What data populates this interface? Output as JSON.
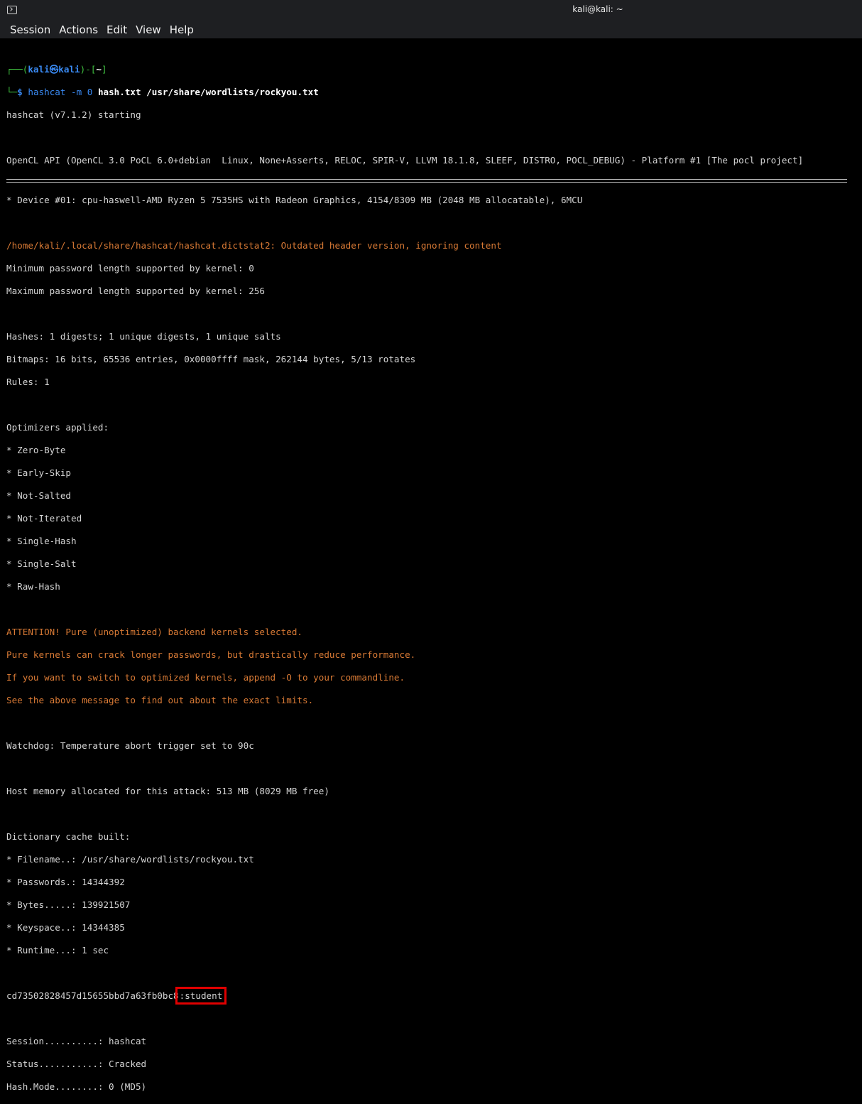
{
  "window": {
    "title": "kali@kali: ~"
  },
  "menu": [
    "Session",
    "Actions",
    "Edit",
    "View",
    "Help"
  ],
  "prompt": {
    "corner_top": "┌──(",
    "user": "kali",
    "at": "㉿",
    "host": "kali",
    "mid": ")-[",
    "dir": "~",
    "end": "]",
    "corner_bottom": "└─",
    "dollar": "$",
    "cmd": "hashcat",
    "args": " -m 0 ",
    "file_args": "hash.txt /usr/share/wordlists/rockyou.txt"
  },
  "lines": {
    "l1": "hashcat (v7.1.2) starting",
    "l2": "OpenCL API (OpenCL 3.0 PoCL 6.0+debian  Linux, None+Asserts, RELOC, SPIR-V, LLVM 18.1.8, SLEEF, DISTRO, POCL_DEBUG) - Platform #1 [The pocl project]",
    "l3": "* Device #01: cpu-haswell-AMD Ryzen 5 7535HS with Radeon Graphics, 4154/8309 MB (2048 MB allocatable), 6MCU",
    "l4": "/home/kali/.local/share/hashcat/hashcat.dictstat2: Outdated header version, ignoring content",
    "l5": "Minimum password length supported by kernel: 0",
    "l6": "Maximum password length supported by kernel: 256",
    "l7": "Hashes: 1 digests; 1 unique digests, 1 unique salts",
    "l8": "Bitmaps: 16 bits, 65536 entries, 0x0000ffff mask, 262144 bytes, 5/13 rotates",
    "l9": "Rules: 1",
    "l10": "Optimizers applied:",
    "l11": "* Zero-Byte",
    "l12": "* Early-Skip",
    "l13": "* Not-Salted",
    "l14": "* Not-Iterated",
    "l15": "* Single-Hash",
    "l16": "* Single-Salt",
    "l17": "* Raw-Hash",
    "l18": "ATTENTION! Pure (unoptimized) backend kernels selected.",
    "l19": "Pure kernels can crack longer passwords, but drastically reduce performance.",
    "l20": "If you want to switch to optimized kernels, append -O to your commandline.",
    "l21": "See the above message to find out about the exact limits.",
    "l22": "Watchdog: Temperature abort trigger set to 90c",
    "l23": "Host memory allocated for this attack: 513 MB (8029 MB free)",
    "l24": "Dictionary cache built:",
    "l25": "* Filename..: /usr/share/wordlists/rockyou.txt",
    "l26": "* Passwords.: 14344392",
    "l27": "* Bytes.....: 139921507",
    "l28": "* Keyspace..: 14344385",
    "l29": "* Runtime...: 1 sec",
    "hash": "cd73502828457d15655bbd7a63fb0bc8",
    "cracked": ":student",
    "l31": "Session..........: hashcat",
    "l32": "Status...........: Cracked",
    "l33": "Hash.Mode........: 0 (MD5)"
  },
  "colors": {
    "prompt_frame": "#3fbf3f",
    "prompt_user": "#3a8bf5",
    "warning": "#d97a35",
    "highlight_box": "#e00000"
  }
}
